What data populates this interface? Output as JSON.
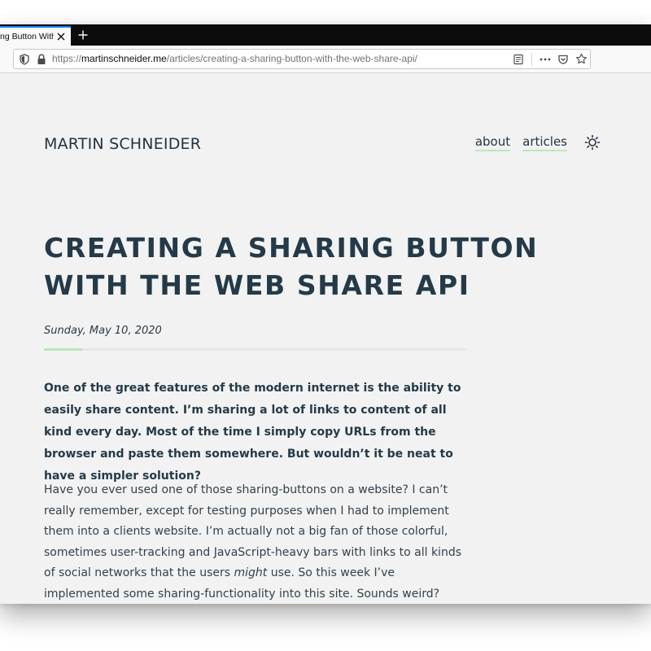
{
  "browser": {
    "tab": {
      "title": "ng Button With"
    },
    "url": {
      "scheme": "https://",
      "host": "martinschneider.me",
      "path": "/articles/creating-a-sharing-button-with-the-web-share-api/"
    },
    "icons": {
      "close": "close-icon",
      "new_tab": "plus-icon",
      "tracking": "shield-icon",
      "secure": "lock-icon",
      "reader": "reader-view-icon",
      "more": "more-actions-icon",
      "pocket": "pocket-icon",
      "bookmark": "star-icon"
    },
    "accent_color": "#0a84ff"
  },
  "site": {
    "title": "MARTIN SCHNEIDER",
    "nav": [
      {
        "label": "about"
      },
      {
        "label": "articles"
      }
    ],
    "theme_toggle_icon": "sun-icon",
    "link_underline_color": "#b9e8b9",
    "text_color": "#243342",
    "background_color": "#f2f2f2"
  },
  "article": {
    "title": "CREATING A SHARING BUTTON WITH THE WEB SHARE API",
    "date": "Sunday, May 10, 2020",
    "lead": "One of the great features of the modern internet is the ability to easily share content. I’m sharing a lot of links to content of all kind every day. Most of the time I simply copy URLs from the browser and paste them somewhere. But wouldn’t it be neat to have a simpler solution?",
    "body_before_em": "Have you ever used one of those sharing-buttons on a website? I can’t really remember, except for testing purposes when I had to implement them into a clients website. I’m actually not a big fan of those colorful, sometimes user-tracking and JavaScript-heavy bars with links to all kinds of social networks that the users ",
    "body_em": "might",
    "body_after_em": " use. So this week I’ve implemented some sharing-functionality into this site. Sounds weird? Read on!"
  }
}
